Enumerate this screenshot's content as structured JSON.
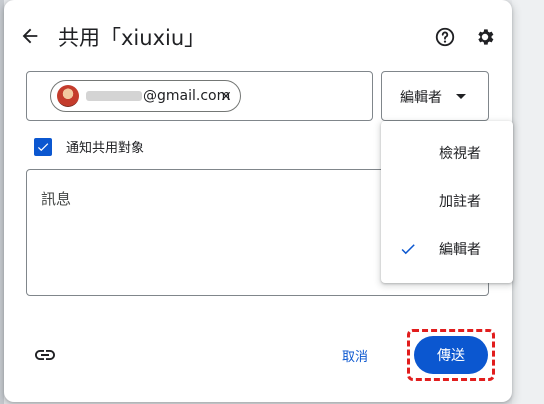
{
  "dialog": {
    "title": "共用「xiuxiu」"
  },
  "recipients": {
    "chip_email": "@gmail.com"
  },
  "role": {
    "selected": "編輯者",
    "options": [
      "檢視者",
      "加註者",
      "編輯者"
    ]
  },
  "notify": {
    "label": "通知共用對象",
    "checked": true
  },
  "message": {
    "placeholder": "訊息"
  },
  "footer": {
    "cancel_label": "取消",
    "send_label": "傳送"
  },
  "icons": {
    "back": "arrow-left-icon",
    "help": "help-circle-icon",
    "settings": "gear-icon",
    "chip_remove": "close-icon",
    "dropdown": "caret-down-icon",
    "checkbox": "check-icon",
    "copy_link": "link-icon",
    "selected_role": "check-icon"
  },
  "colors": {
    "accent": "#0b57d0",
    "highlight": "#e11d1d"
  }
}
